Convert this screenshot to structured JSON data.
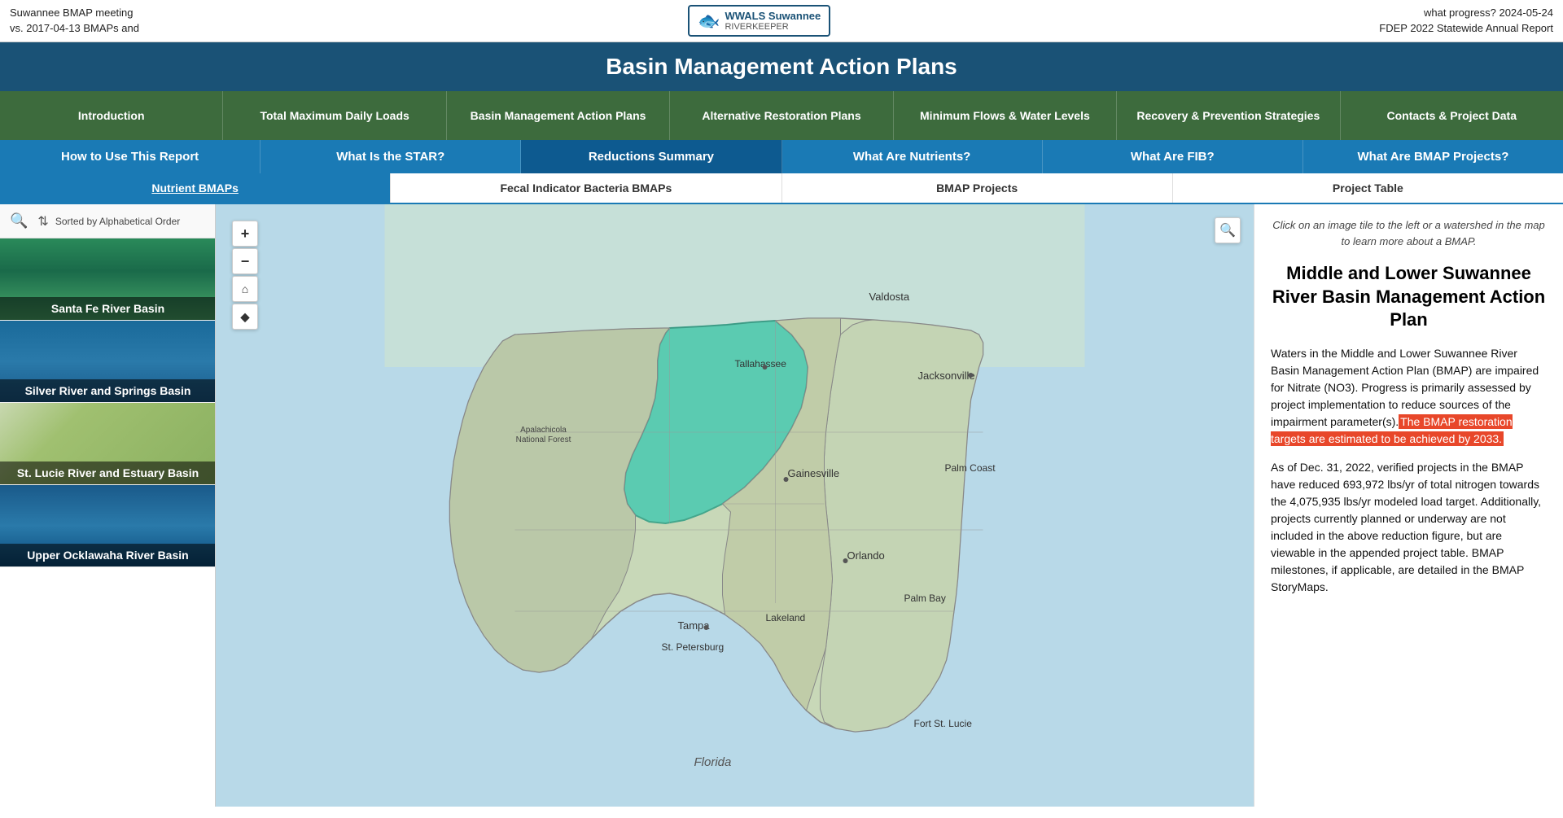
{
  "topbar": {
    "left_line1": "Suwannee BMAP meeting",
    "left_line2": "vs. 2017-04-13 BMAPs and",
    "right_line1": "what progress? 2024-05-24",
    "right_line2": "FDEP 2022 Statewide Annual Report",
    "logo_line1": "Suwannee",
    "logo_line2": "RIVERKEEPER",
    "logo_sub": "WWALS"
  },
  "main_title": "Basin Management Action Plans",
  "nav1": {
    "items": [
      {
        "label": "Introduction"
      },
      {
        "label": "Total Maximum Daily Loads"
      },
      {
        "label": "Basin Management Action Plans"
      },
      {
        "label": "Alternative Restoration Plans"
      },
      {
        "label": "Minimum Flows & Water Levels"
      },
      {
        "label": "Recovery & Prevention Strategies"
      },
      {
        "label": "Contacts & Project Data"
      }
    ]
  },
  "nav2": {
    "items": [
      {
        "label": "How to Use This Report"
      },
      {
        "label": "What Is the STAR?"
      },
      {
        "label": "Reductions Summary",
        "active": true
      },
      {
        "label": "What Are Nutrients?"
      },
      {
        "label": "What Are FIB?"
      },
      {
        "label": "What Are BMAP Projects?"
      }
    ]
  },
  "nav3": {
    "items": [
      {
        "label": "Nutrient BMAPs",
        "active": true
      },
      {
        "label": "Fecal Indicator Bacteria BMAPs"
      },
      {
        "label": "BMAP Projects"
      },
      {
        "label": "Project Table"
      }
    ]
  },
  "sidebar": {
    "sort_label": "Sorted by Alphabetical Order",
    "basins": [
      {
        "label": "Santa Fe River Basin",
        "style": "santa-fe"
      },
      {
        "label": "Silver River and Springs Basin",
        "style": "silver"
      },
      {
        "label": "St. Lucie River and Estuary Basin",
        "style": "st-lucie"
      },
      {
        "label": "Upper Ocklawaha River Basin",
        "style": "upper-ock"
      }
    ]
  },
  "map": {
    "labels": [
      "Valdosta",
      "Tallahassee",
      "Jacksonville",
      "Apalachicola National Forest",
      "Gainesville",
      "Palm Coast",
      "Orlando",
      "Tampa",
      "St. Petersburg",
      "Lakeland",
      "Palm Bay",
      "Fort St. Lucie",
      "Florida"
    ]
  },
  "right_panel": {
    "hint": "Click on an image tile to the left or a watershed in the map to learn more about a BMAP.",
    "title": "Middle and Lower Suwannee River Basin Management Action Plan",
    "para1": "Waters in the Middle and Lower Suwannee River Basin Management Action Plan (BMAP) are impaired for Nitrate (NO3). Progress is primarily assessed by project implementation to reduce sources of the impairment parameter(s).",
    "highlight": "The BMAP restoration targets are estimated to be achieved by 2033.",
    "para2": "As of Dec. 31, 2022, verified projects in the BMAP have reduced 693,972 lbs/yr of total nitrogen towards the 4,075,935 lbs/yr modeled load target. Additionally, projects currently planned or underway are not included in the above reduction figure, but are viewable in the appended project table. BMAP milestones, if applicable, are detailed in the BMAP StoryMaps."
  }
}
